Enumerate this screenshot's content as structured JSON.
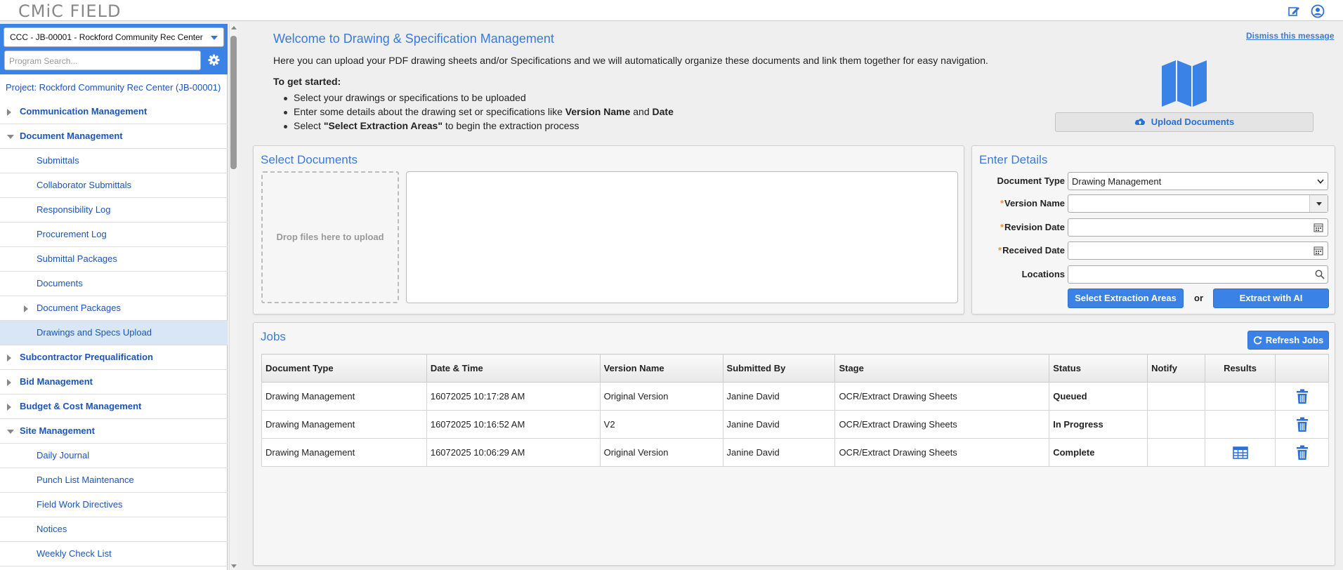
{
  "app": {
    "logo": "CMiC FIELD"
  },
  "header": {
    "edit_icon": "edit-icon",
    "user_icon": "user-circle-icon"
  },
  "sidebar": {
    "project_select": "CCC - JB-00001 - Rockford Community Rec Center",
    "search_placeholder": "Program Search...",
    "project_label": "Project: Rockford Community Rec Center (JB-00001)",
    "items": [
      {
        "label": "Communication Management",
        "level": 0,
        "arrow": "right"
      },
      {
        "label": "Document Management",
        "level": 0,
        "arrow": "down"
      },
      {
        "label": "Submittals",
        "level": 1
      },
      {
        "label": "Collaborator Submittals",
        "level": 1
      },
      {
        "label": "Responsibility Log",
        "level": 1
      },
      {
        "label": "Procurement Log",
        "level": 1
      },
      {
        "label": "Submittal Packages",
        "level": 1
      },
      {
        "label": "Documents",
        "level": 1
      },
      {
        "label": "Document Packages",
        "level": 1,
        "arrow": "right"
      },
      {
        "label": "Drawings and Specs Upload",
        "level": 1,
        "active": true
      },
      {
        "label": "Subcontractor Prequalification",
        "level": 0,
        "arrow": "right"
      },
      {
        "label": "Bid Management",
        "level": 0,
        "arrow": "right"
      },
      {
        "label": "Budget & Cost Management",
        "level": 0,
        "arrow": "right"
      },
      {
        "label": "Site Management",
        "level": 0,
        "arrow": "down"
      },
      {
        "label": "Daily Journal",
        "level": 1
      },
      {
        "label": "Punch List Maintenance",
        "level": 1
      },
      {
        "label": "Field Work Directives",
        "level": 1
      },
      {
        "label": "Notices",
        "level": 1
      },
      {
        "label": "Weekly Check List",
        "level": 1
      }
    ]
  },
  "welcome": {
    "title": "Welcome to Drawing & Specification Management",
    "dismiss": "Dismiss this message",
    "intro": "Here you can upload your PDF drawing sheets and/or Specifications and we will automatically organize these documents and link them together for easy navigation.",
    "get_started": "To get started:",
    "b1": "Select your drawings or specifications to be uploaded",
    "b2_pre": "Enter some details about the drawing set or specifications like ",
    "b2_vn": "Version Name",
    "b2_and": " and ",
    "b2_date": "Date",
    "b3_pre": "Select ",
    "b3_bold": "\"Select Extraction Areas\"",
    "b3_post": " to begin the extraction process",
    "upload_button": "Upload Documents"
  },
  "select_documents": {
    "title": "Select Documents",
    "drop_text": "Drop files here to upload"
  },
  "details": {
    "title": "Enter Details",
    "document_type_label": "Document Type",
    "document_type_value": "Drawing Management",
    "version_name_label": "Version Name",
    "revision_date_label": "Revision Date",
    "received_date_label": "Received Date",
    "locations_label": "Locations",
    "required_mark": "*",
    "select_extraction": "Select Extraction Areas",
    "or": "or",
    "extract_ai": "Extract with AI"
  },
  "jobs": {
    "title": "Jobs",
    "refresh": "Refresh Jobs",
    "columns": [
      "Document Type",
      "Date & Time",
      "Version Name",
      "Submitted By",
      "Stage",
      "Status",
      "Notify",
      "Results",
      ""
    ],
    "rows": [
      {
        "doc_type": "Drawing Management",
        "datetime": "16072025 10:17:28 AM",
        "version": "Original Version",
        "submitted_by": "Janine David",
        "stage": "OCR/Extract Drawing Sheets",
        "status": "Queued",
        "results_icon": ""
      },
      {
        "doc_type": "Drawing Management",
        "datetime": "16072025 10:16:52 AM",
        "version": "V2",
        "submitted_by": "Janine David",
        "stage": "OCR/Extract Drawing Sheets",
        "status": "In Progress",
        "results_icon": ""
      },
      {
        "doc_type": "Drawing Management",
        "datetime": "16072025 10:06:29 AM",
        "version": "Original Version",
        "submitted_by": "Janine David",
        "stage": "OCR/Extract Drawing Sheets",
        "status": "Complete",
        "results_icon": "table-grid-icon"
      }
    ]
  },
  "colors": {
    "accent": "#3b82e6",
    "link": "#1c55b8",
    "queued": "#888888",
    "in_progress": "#2f7ae0",
    "complete": "#3aa52a"
  }
}
